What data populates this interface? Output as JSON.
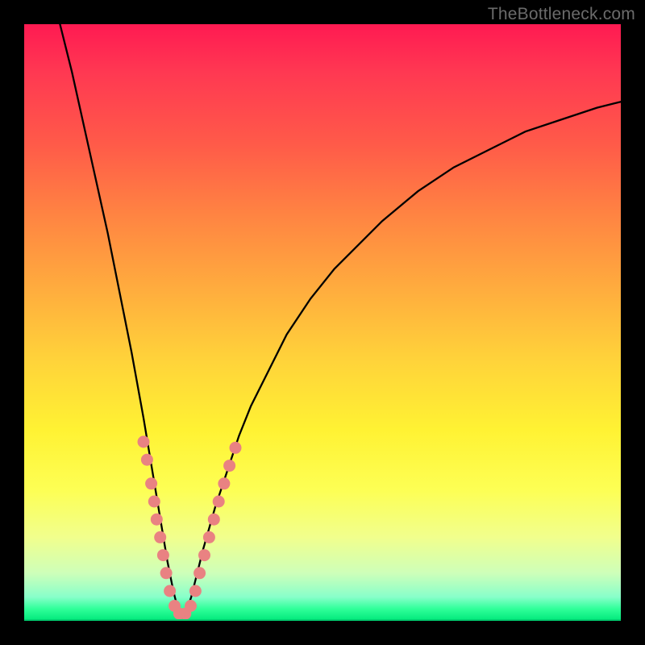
{
  "watermark": "TheBottleneck.com",
  "colors": {
    "frame": "#000000",
    "curve": "#000000",
    "dots": "#e98282",
    "gradient_top": "#ff1a52",
    "gradient_bottom": "#00e87a"
  },
  "chart_data": {
    "type": "line",
    "title": "",
    "xlabel": "",
    "ylabel": "",
    "xlim": [
      0,
      100
    ],
    "ylim": [
      0,
      100
    ],
    "note": "No axis ticks or numeric labels are visible; x/y are normalized to 0-100 from pixel position. Higher y = higher on screen. Curve is a V-shaped bottleneck profile touching the bottom near x≈26.",
    "series": [
      {
        "name": "curve",
        "x": [
          6,
          8,
          10,
          12,
          14,
          16,
          18,
          20,
          21,
          22,
          23,
          24,
          25,
          26,
          27,
          28,
          29,
          30,
          32,
          34,
          36,
          38,
          40,
          44,
          48,
          52,
          56,
          60,
          66,
          72,
          78,
          84,
          90,
          96,
          100
        ],
        "y": [
          100,
          92,
          83,
          74,
          65,
          55,
          45,
          34,
          28,
          22,
          16,
          10,
          5,
          1,
          1,
          4,
          8,
          12,
          19,
          25,
          31,
          36,
          40,
          48,
          54,
          59,
          63,
          67,
          72,
          76,
          79,
          82,
          84,
          86,
          87
        ]
      }
    ],
    "dots": [
      {
        "x": 20.0,
        "y": 30
      },
      {
        "x": 20.6,
        "y": 27
      },
      {
        "x": 21.3,
        "y": 23
      },
      {
        "x": 21.8,
        "y": 20
      },
      {
        "x": 22.2,
        "y": 17
      },
      {
        "x": 22.8,
        "y": 14
      },
      {
        "x": 23.3,
        "y": 11
      },
      {
        "x": 23.8,
        "y": 8
      },
      {
        "x": 24.4,
        "y": 5
      },
      {
        "x": 25.2,
        "y": 2.5
      },
      {
        "x": 26.0,
        "y": 1.2
      },
      {
        "x": 27.0,
        "y": 1.2
      },
      {
        "x": 27.9,
        "y": 2.5
      },
      {
        "x": 28.7,
        "y": 5
      },
      {
        "x": 29.4,
        "y": 8
      },
      {
        "x": 30.2,
        "y": 11
      },
      {
        "x": 31.0,
        "y": 14
      },
      {
        "x": 31.8,
        "y": 17
      },
      {
        "x": 32.6,
        "y": 20
      },
      {
        "x": 33.5,
        "y": 23
      },
      {
        "x": 34.4,
        "y": 26
      },
      {
        "x": 35.4,
        "y": 29
      }
    ]
  }
}
